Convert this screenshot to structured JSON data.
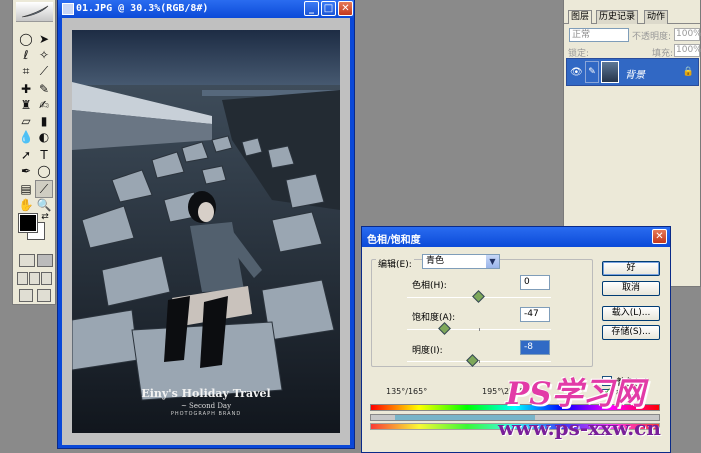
{
  "document": {
    "title": "01.JPG @ 30.3%(RGB/8#)",
    "photo_caption": {
      "title": "Einy's Holiday Travel",
      "subtitle": "~ Second Day",
      "credit": "PHOTOGRAPH BRAND"
    }
  },
  "window_controls": {
    "minimize": "_",
    "maximize": "□",
    "close": "✕"
  },
  "toolbox": {
    "tools": [
      "marquee-tool",
      "move-tool",
      "lasso-tool",
      "magic-wand-tool",
      "crop-tool",
      "slice-tool",
      "healing-brush-tool",
      "brush-tool",
      "clone-stamp-tool",
      "history-brush-tool",
      "eraser-tool",
      "gradient-tool",
      "blur-tool",
      "dodge-tool",
      "path-selection-tool",
      "type-tool",
      "pen-tool",
      "shape-tool",
      "notes-tool",
      "eyedropper-tool",
      "hand-tool",
      "zoom-tool"
    ],
    "foreground_color": "#000000",
    "background_color": "#ffffff"
  },
  "layers_panel": {
    "tabs": [
      "图层",
      "历史记录",
      "动作"
    ],
    "blend_mode": "正常",
    "opacity_label": "不透明度:",
    "opacity_value": "100%",
    "lock_label": "锁定:",
    "fill_label": "填充:",
    "fill_value": "100%",
    "layer_name": "背景"
  },
  "dialog": {
    "title": "色相/饱和度",
    "edit_label": "编辑(E):",
    "edit_value": "青色",
    "params": [
      {
        "label": "色相(H):",
        "value": "0",
        "position": 0.5
      },
      {
        "label": "饱和度(A):",
        "value": "-47",
        "position": 0.265
      },
      {
        "label": "明度(I):",
        "value": "-8",
        "position": 0.46
      }
    ],
    "buttons": {
      "ok": "好",
      "cancel": "取消",
      "load": "载入(L)...",
      "save": "存储(S)..."
    },
    "checkboxes": [
      {
        "label": "着色(O)",
        "checked": false
      },
      {
        "label": "预览(P)",
        "checked": true
      }
    ],
    "range_left": "135°/165°",
    "range_right": "195°\\225°"
  },
  "watermark": {
    "line1": "PS学习网",
    "line2": "www.ps-xxw.cn"
  }
}
